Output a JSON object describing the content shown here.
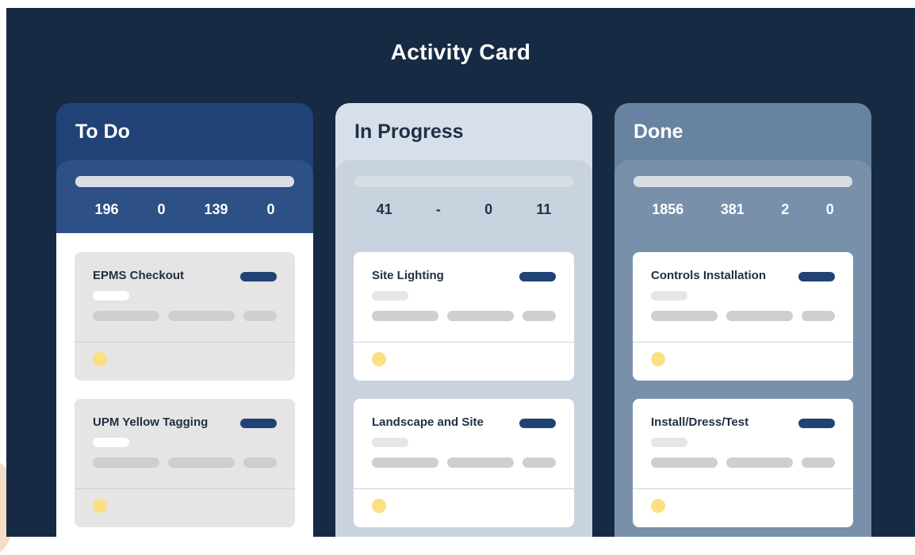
{
  "title": "Activity Card",
  "colors": {
    "background": "#172a44",
    "todo": "#214274",
    "in_progress": "#d7dfea",
    "done": "#68839f",
    "accent_pill": "#214274",
    "status_dot": "#fbe083"
  },
  "columns": [
    {
      "name": "To Do",
      "progress_fraction": 1.0,
      "stats": [
        "196",
        "0",
        "139",
        "0"
      ],
      "cards": [
        {
          "title": "EPMS Checkout",
          "status_icon": "yellow-dot-icon"
        },
        {
          "title": "UPM Yellow Tagging",
          "status_icon": "yellow-dot-icon"
        }
      ]
    },
    {
      "name": "In Progress",
      "progress_fraction": 1.0,
      "stats": [
        "41",
        "-",
        "0",
        "11"
      ],
      "cards": [
        {
          "title": "Site Lighting",
          "status_icon": "yellow-dot-icon"
        },
        {
          "title": "Landscape and Site",
          "status_icon": "yellow-dot-icon"
        }
      ]
    },
    {
      "name": "Done",
      "progress_fraction": 1.0,
      "stats": [
        "1856",
        "381",
        "2",
        "0"
      ],
      "cards": [
        {
          "title": "Controls Installation",
          "status_icon": "yellow-dot-icon"
        },
        {
          "title": "Install/Dress/Test",
          "status_icon": "yellow-dot-icon"
        }
      ]
    }
  ]
}
